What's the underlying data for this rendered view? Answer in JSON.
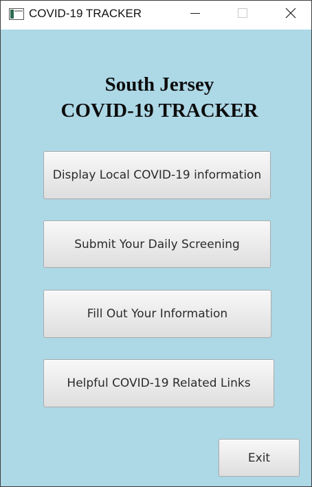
{
  "window": {
    "title": "COVID-19 TRACKER",
    "icons": {
      "app": "java-app-icon",
      "minimize": "minimize-icon",
      "maximize": "maximize-icon",
      "close": "close-icon"
    }
  },
  "heading": {
    "line1": "South Jersey",
    "line2": "COVID-19 TRACKER"
  },
  "menu": {
    "buttons": [
      {
        "label": "Display Local COVID-19 information"
      },
      {
        "label": "Submit Your Daily Screening"
      },
      {
        "label": "Fill Out Your Information"
      },
      {
        "label": "Helpful COVID-19 Related Links"
      }
    ],
    "exit_label": "Exit"
  },
  "colors": {
    "background": "#add8e6",
    "title_bar": "#ffffff",
    "button_top": "#f8f8f8",
    "button_bottom": "#dedede"
  }
}
